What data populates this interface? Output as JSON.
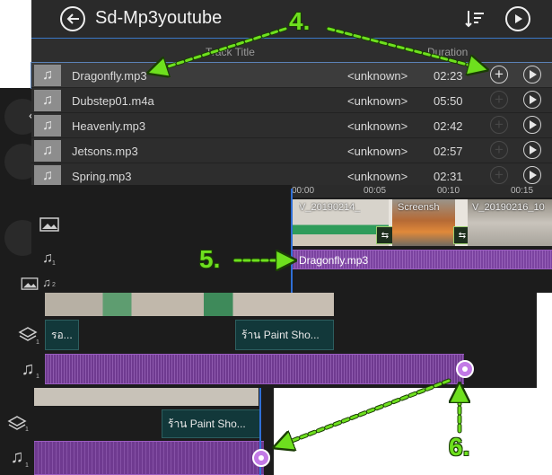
{
  "media_list": {
    "title": "Sd-Mp3youtube",
    "back_icon": "back-arrow-icon",
    "sort_icon": "sort-icon",
    "play_all_icon": "play-circle-icon",
    "columns": {
      "track_title": "Track Title",
      "duration": "Duration"
    },
    "tracks": [
      {
        "name": "Dragonfly.mp3",
        "artist": "<unknown>",
        "duration": "02:23",
        "selected": true
      },
      {
        "name": "Dubstep01.m4a",
        "artist": "<unknown>",
        "duration": "05:50",
        "selected": false
      },
      {
        "name": "Heavenly.mp3",
        "artist": "<unknown>",
        "duration": "02:42",
        "selected": false
      },
      {
        "name": "Jetsons.mp3",
        "artist": "<unknown>",
        "duration": "02:57",
        "selected": false
      },
      {
        "name": "Spring.mp3",
        "artist": "<unknown>",
        "duration": "02:31",
        "selected": false
      }
    ]
  },
  "timeline": {
    "ruler_ticks": [
      "00:00",
      "00:05",
      "00:10",
      "00:15"
    ],
    "video_clips": [
      "V_20190214_",
      "Screensh",
      "V_20190216_10"
    ],
    "audio_clip": "Dragonfly.mp3",
    "track_numbers": {
      "audio": "1",
      "audio_second": "2"
    }
  },
  "back_layers": {
    "middle": {
      "layer_text_left": "รอ...",
      "layer_text": "ร้าน Paint Sho...",
      "layer_number": "1",
      "audio_number": "1"
    },
    "bottom": {
      "layer_text": "ร้าน Paint Sho...",
      "layer_number": "1",
      "audio_number": "1"
    }
  },
  "annotations": {
    "step4": "4.",
    "step5": "5.",
    "step6": "6."
  },
  "colors": {
    "accent_green": "#6ee01e",
    "audio_purple": "#6f3a90",
    "playhead_blue": "#2f6fd6",
    "list_accent": "#3a78c8"
  }
}
